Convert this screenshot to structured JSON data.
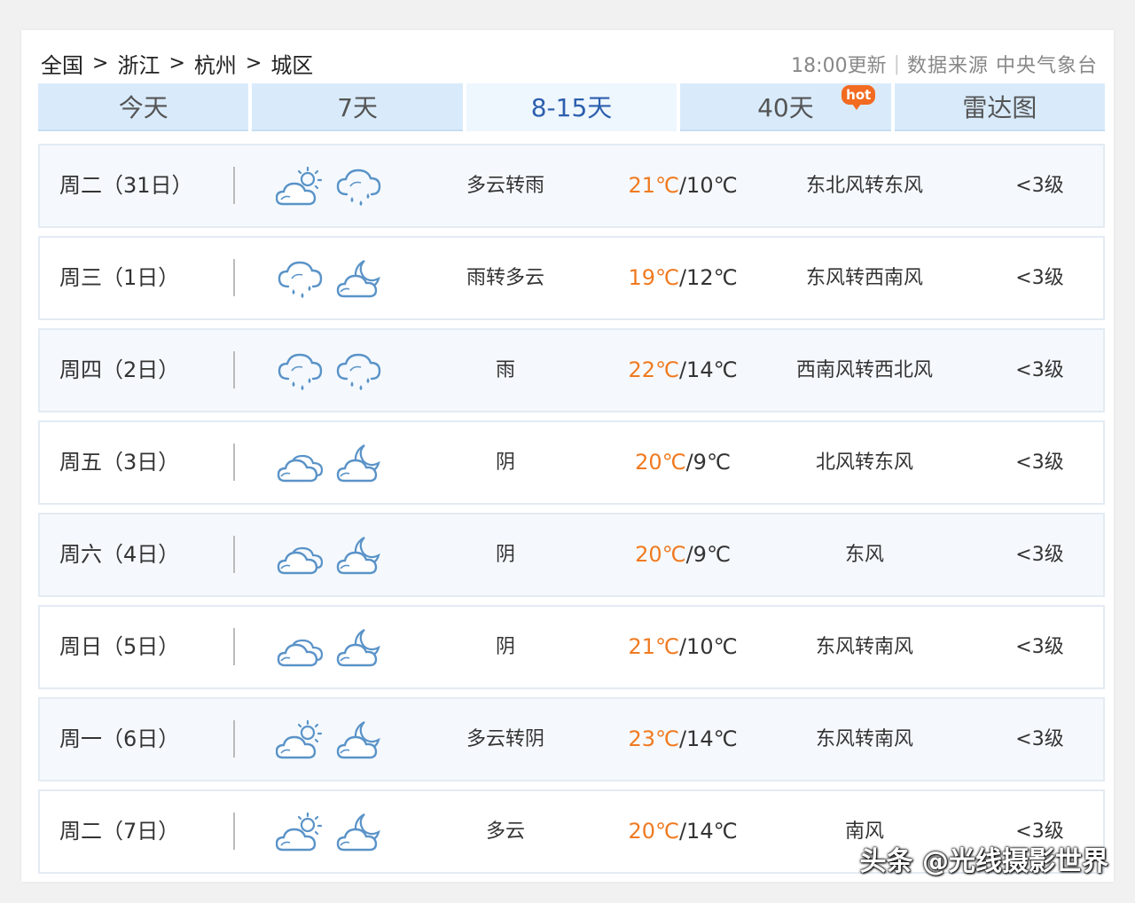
{
  "breadcrumb": {
    "items": [
      "全国",
      "浙江",
      "杭州",
      "城区"
    ],
    "separator": ">"
  },
  "meta": {
    "update": "18:00更新",
    "divider": "|",
    "source": "数据来源 中央气象台"
  },
  "tabs": [
    {
      "label": "今天"
    },
    {
      "label": "7天"
    },
    {
      "label": "8-15天",
      "active": true
    },
    {
      "label": "40天",
      "badge": "hot"
    },
    {
      "label": "雷达图"
    }
  ],
  "forecast": [
    {
      "day": "周二（31日）",
      "icon_day": "partly-cloudy-sun-icon",
      "icon_night": "rain-cloud-icon",
      "desc": "多云转雨",
      "high": "21℃",
      "low": "10℃",
      "wind": "东北风转东风",
      "level": "<3级"
    },
    {
      "day": "周三（1日）",
      "icon_day": "rain-cloud-icon",
      "icon_night": "cloudy-moon-icon",
      "desc": "雨转多云",
      "high": "19℃",
      "low": "12℃",
      "wind": "东风转西南风",
      "level": "<3级"
    },
    {
      "day": "周四（2日）",
      "icon_day": "rain-cloud-icon",
      "icon_night": "rain-cloud-icon",
      "desc": "雨",
      "high": "22℃",
      "low": "14℃",
      "wind": "西南风转西北风",
      "level": "<3级"
    },
    {
      "day": "周五（3日）",
      "icon_day": "overcast-icon",
      "icon_night": "cloudy-moon-icon",
      "desc": "阴",
      "high": "20℃",
      "low": "9℃",
      "wind": "北风转东风",
      "level": "<3级"
    },
    {
      "day": "周六（4日）",
      "icon_day": "overcast-icon",
      "icon_night": "cloudy-moon-icon",
      "desc": "阴",
      "high": "20℃",
      "low": "9℃",
      "wind": "东风",
      "level": "<3级"
    },
    {
      "day": "周日（5日）",
      "icon_day": "overcast-icon",
      "icon_night": "cloudy-moon-icon",
      "desc": "阴",
      "high": "21℃",
      "low": "10℃",
      "wind": "东风转南风",
      "level": "<3级"
    },
    {
      "day": "周一（6日）",
      "icon_day": "partly-cloudy-sun-icon",
      "icon_night": "cloudy-moon-icon",
      "desc": "多云转阴",
      "high": "23℃",
      "low": "14℃",
      "wind": "东风转南风",
      "level": "<3级"
    },
    {
      "day": "周二（7日）",
      "icon_day": "partly-cloudy-sun-icon",
      "icon_night": "cloudy-moon-icon",
      "desc": "多云",
      "high": "20℃",
      "low": "14℃",
      "wind": "南风",
      "level": "<3级"
    }
  ],
  "temp_separator": "/",
  "colors": {
    "tab_bg": "#d9ebfb",
    "tab_active_text": "#2c5fae",
    "high_temp": "#f07a20",
    "icon_stroke": "#5a93c8"
  },
  "watermark": "头条 @光线摄影世界"
}
